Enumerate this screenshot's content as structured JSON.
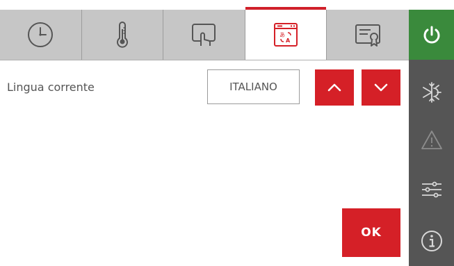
{
  "tabs": [
    {
      "icon": "clock-icon",
      "active": false
    },
    {
      "icon": "thermometer-icon",
      "active": false
    },
    {
      "icon": "touch-display-icon",
      "active": false
    },
    {
      "icon": "language-window-icon",
      "active": true
    },
    {
      "icon": "certificate-icon",
      "active": false
    }
  ],
  "rail": {
    "power_icon": "power-icon",
    "items": [
      "snowflake-sun-icon",
      "warning-icon",
      "sliders-icon",
      "info-icon"
    ]
  },
  "language": {
    "label": "Lingua corrente",
    "value": "ITALIANO",
    "up_icon": "chevron-up-icon",
    "down_icon": "chevron-down-icon"
  },
  "ok_label": "OK",
  "colors": {
    "accent_red": "#d52027",
    "power_green": "#3a8a3c",
    "rail_gray": "#555555",
    "tab_gray": "#c6c6c6"
  }
}
